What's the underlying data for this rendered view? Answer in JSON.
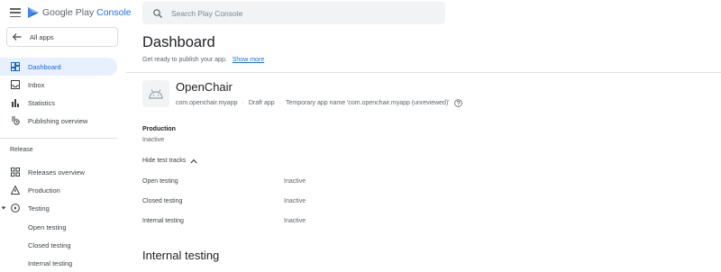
{
  "header": {
    "brand_prefix": "Google Play",
    "brand_suffix": "Console",
    "search_placeholder": "Search Play Console"
  },
  "sidebar": {
    "all_apps_label": "All apps",
    "items": [
      {
        "label": "Dashboard",
        "icon": "dashboard-icon",
        "active": true
      },
      {
        "label": "Inbox",
        "icon": "inbox-icon"
      },
      {
        "label": "Statistics",
        "icon": "bar-chart-icon"
      },
      {
        "label": "Publishing overview",
        "icon": "publishing-overview-icon"
      }
    ],
    "section_label": "Release",
    "release_items": [
      {
        "label": "Releases overview",
        "icon": "releases-overview-icon"
      },
      {
        "label": "Production",
        "icon": "production-icon"
      },
      {
        "label": "Testing",
        "icon": "testing-icon"
      }
    ],
    "testing_sub_items": [
      {
        "label": "Open testing"
      },
      {
        "label": "Closed testing"
      },
      {
        "label": "Internal testing"
      }
    ]
  },
  "main": {
    "title": "Dashboard",
    "subtitle": "Get ready to publish your app.",
    "show_more_link": "Show more",
    "app": {
      "name": "OpenChair",
      "package": "com.openchair.myapp",
      "state": "Draft app",
      "temp_name": "Temporary app name 'com.openchair.myapp (unreviewed)'"
    },
    "production": {
      "label": "Production",
      "status": "Inactive"
    },
    "toggle_label": "Hide test tracks",
    "test_tracks": [
      {
        "name": "Open testing",
        "status": "Inactive"
      },
      {
        "name": "Closed testing",
        "status": "Inactive"
      },
      {
        "name": "Internal testing",
        "status": "Inactive"
      }
    ],
    "section_heading": "Internal testing"
  },
  "colors": {
    "accent": "#1a73e8",
    "active_bg": "#e8f0fe",
    "text_secondary": "#5f6368"
  }
}
